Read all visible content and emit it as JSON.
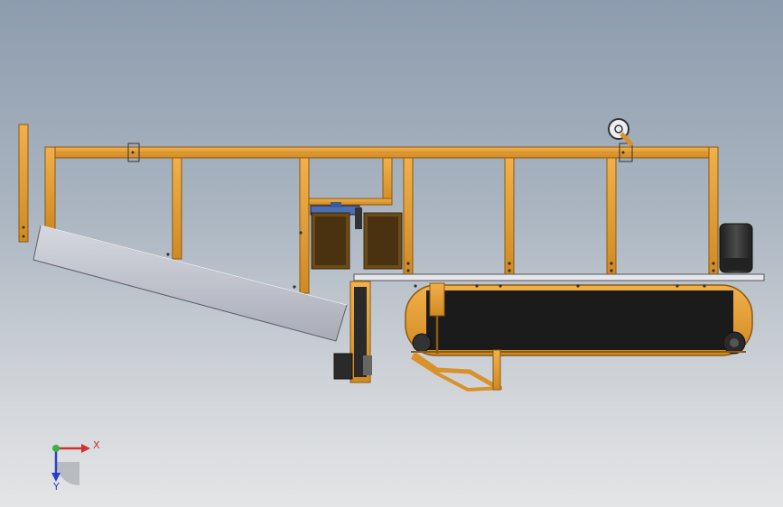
{
  "viewport": {
    "background_top": "#8d9cae",
    "background_bottom": "#e4e5e7"
  },
  "colors": {
    "frame": "#e09a2f",
    "frame_edge": "#8a5a12",
    "belt": "#1b1b1b",
    "chute": "#bfc1ca",
    "plate": "#e7e8ee",
    "motor_blue": "#4a6fb3",
    "motor_dark": "#2a2a2a"
  },
  "axis_triad": {
    "x_label": "X",
    "y_label": "Y",
    "x_color": "#d03030",
    "y_color": "#2a3fc8",
    "origin_color": "#3cb043"
  },
  "icons": {
    "triad": "coordinate-triad-icon"
  }
}
